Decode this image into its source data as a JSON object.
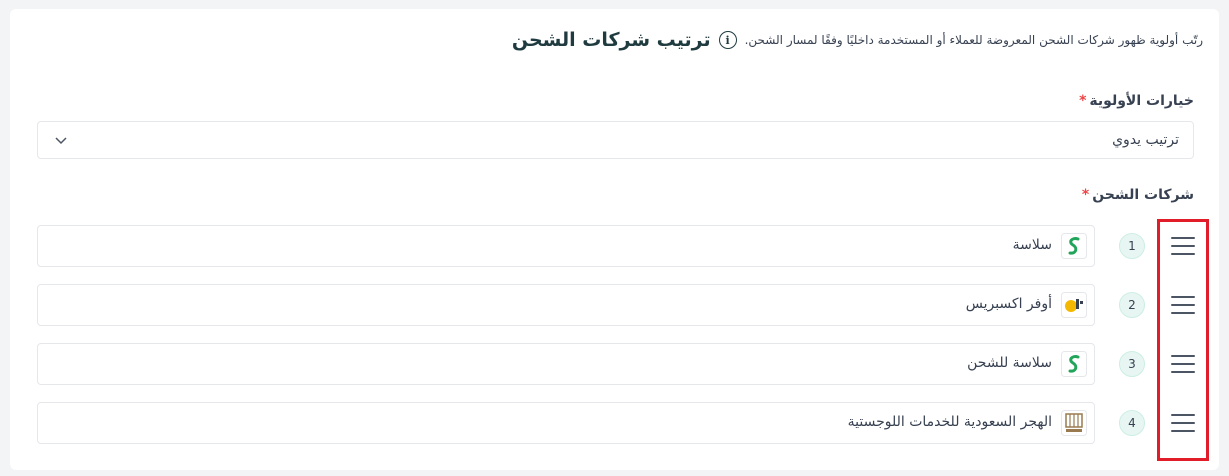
{
  "header": {
    "title": "ترتيب شركات الشحن",
    "subtitle": "رتّب أولوية ظهور شركات الشحن المعروضة للعملاء أو المستخدمة داخليًا وفقًا لمسار الشحن."
  },
  "priority": {
    "label": "خيارات الأولوية",
    "required_mark": "*",
    "selected": "ترتيب يدوي"
  },
  "carriers": {
    "label": "شركات الشحن",
    "required_mark": "*",
    "items": [
      {
        "index": "1",
        "name": "سلاسة",
        "logo": "smsa-logo"
      },
      {
        "index": "2",
        "name": "أوفر اكسبريس",
        "logo": "ofr-logo"
      },
      {
        "index": "3",
        "name": "سلاسة للشحن",
        "logo": "smsa-logo"
      },
      {
        "index": "4",
        "name": "الهجر السعودية للخدمات اللوجستية",
        "logo": "hajr-logo"
      }
    ]
  },
  "colors": {
    "accent": "#1f3b3f",
    "badge_bg": "#e7f6f2",
    "required": "#ef4444",
    "highlight": "#e11d2a"
  }
}
